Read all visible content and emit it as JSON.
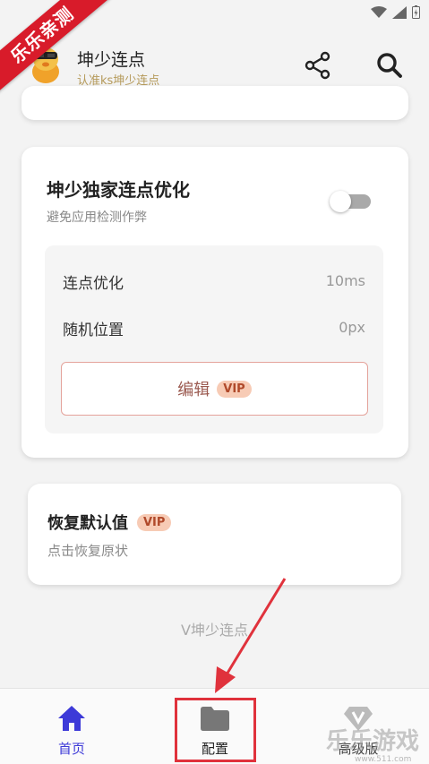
{
  "ribbon": "乐乐亲测",
  "app": {
    "title": "坤少连点",
    "subtitle": "认准ks坤少连点"
  },
  "main_card": {
    "title": "坤少独家连点优化",
    "subtitle": "避免应用检测作弊",
    "toggle_on": false,
    "rows": [
      {
        "label": "连点优化",
        "value": "10ms"
      },
      {
        "label": "随机位置",
        "value": "0px"
      }
    ],
    "edit_label": "编辑",
    "vip": "VIP"
  },
  "reset_card": {
    "title": "恢复默认值",
    "vip": "VIP",
    "subtitle": "点击恢复原状"
  },
  "footer": "V坤少连点",
  "nav": [
    {
      "label": "首页",
      "icon": "home-icon"
    },
    {
      "label": "配置",
      "icon": "folder-icon"
    },
    {
      "label": "高级版",
      "icon": "diamond-icon"
    }
  ],
  "watermark": {
    "text": "乐乐游戏",
    "url": "www.511.com"
  },
  "colors": {
    "accent": "#3d3ad8",
    "vip_bg": "#f7cbb5",
    "vip_text": "#b0492a",
    "highlight": "#e0323c",
    "ribbon": "#d81b2a"
  }
}
